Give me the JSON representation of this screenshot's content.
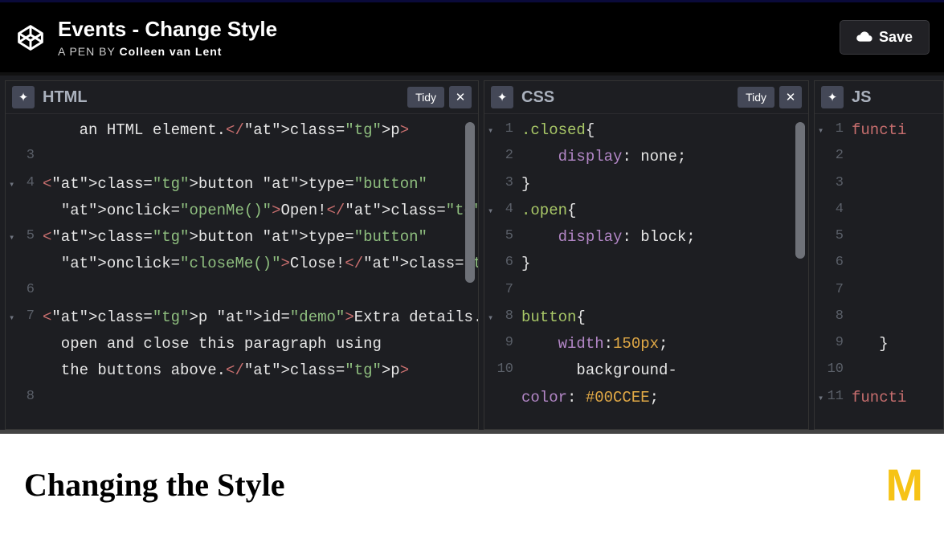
{
  "header": {
    "title": "Events - Change Style",
    "pen_by_prefix": "A PEN BY",
    "author": "Colleen van Lent",
    "save_label": "Save"
  },
  "panels": {
    "html": {
      "label": "HTML",
      "tidy_label": "Tidy",
      "lines": [
        "",
        "3",
        "4",
        "",
        "5",
        "",
        "6",
        "7",
        "",
        "",
        "8"
      ],
      "fold_lines": [
        2,
        4,
        7
      ],
      "code_rows": [
        {
          "raw": "    an HTML element.</p>"
        },
        {
          "raw": ""
        },
        {
          "raw": "<button type=\"button\""
        },
        {
          "raw": "  onclick=\"openMe()\">Open!</button>"
        },
        {
          "raw": "<button type=\"button\""
        },
        {
          "raw": "  onclick=\"closeMe()\">Close!</button>"
        },
        {
          "raw": ""
        },
        {
          "raw": "<p id=\"demo\">Extra details...You can"
        },
        {
          "raw": "  open and close this paragraph using"
        },
        {
          "raw": "  the buttons above.</p>"
        },
        {
          "raw": ""
        }
      ]
    },
    "css": {
      "label": "CSS",
      "tidy_label": "Tidy",
      "lines": [
        "1",
        "2",
        "3",
        "4",
        "5",
        "6",
        "7",
        "8",
        "9",
        "10",
        ""
      ],
      "fold_lines": [
        0,
        3,
        7
      ],
      "code_rows": [
        ".closed{",
        "    display: none;",
        "}",
        ".open{",
        "    display: block;",
        "}",
        "",
        "button{",
        "    width:150px;",
        "      background-",
        "color: #00CCEE;"
      ]
    },
    "js": {
      "label": "JS",
      "lines": [
        "1",
        "2",
        "3",
        "4",
        "5",
        "6",
        "7",
        "8",
        "9",
        "10",
        "11"
      ],
      "fold_lines": [
        0,
        10
      ],
      "code_rows": [
        "functi",
        "",
        "",
        "",
        "",
        "",
        "",
        "",
        "   }",
        "",
        "functi"
      ]
    }
  },
  "preview": {
    "heading": "Changing the Style",
    "logo_text": "M"
  },
  "icons": {
    "gear": "gear",
    "close": "close",
    "cloud": "cloud"
  },
  "colors": {
    "accent_yellow": "#f6c316",
    "bg_dark": "#1d1e22"
  },
  "chart_data": null
}
